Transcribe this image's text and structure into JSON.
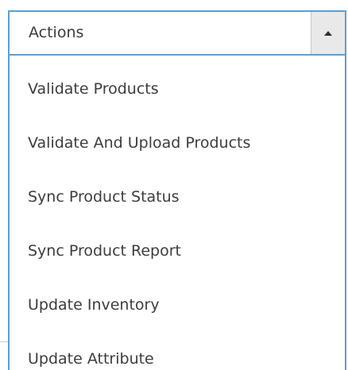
{
  "dropdown": {
    "label": "Actions",
    "arrow_icon": "caret-up-icon",
    "items": [
      {
        "label": "Validate Products"
      },
      {
        "label": "Validate And Upload Products"
      },
      {
        "label": "Sync Product Status"
      },
      {
        "label": "Sync Product Report"
      },
      {
        "label": "Update Inventory"
      },
      {
        "label": "Update Attribute"
      }
    ]
  },
  "colors": {
    "border": "#5a9fd6",
    "arrow_box": "#e9e9e9",
    "text": "#3d3d3d"
  }
}
